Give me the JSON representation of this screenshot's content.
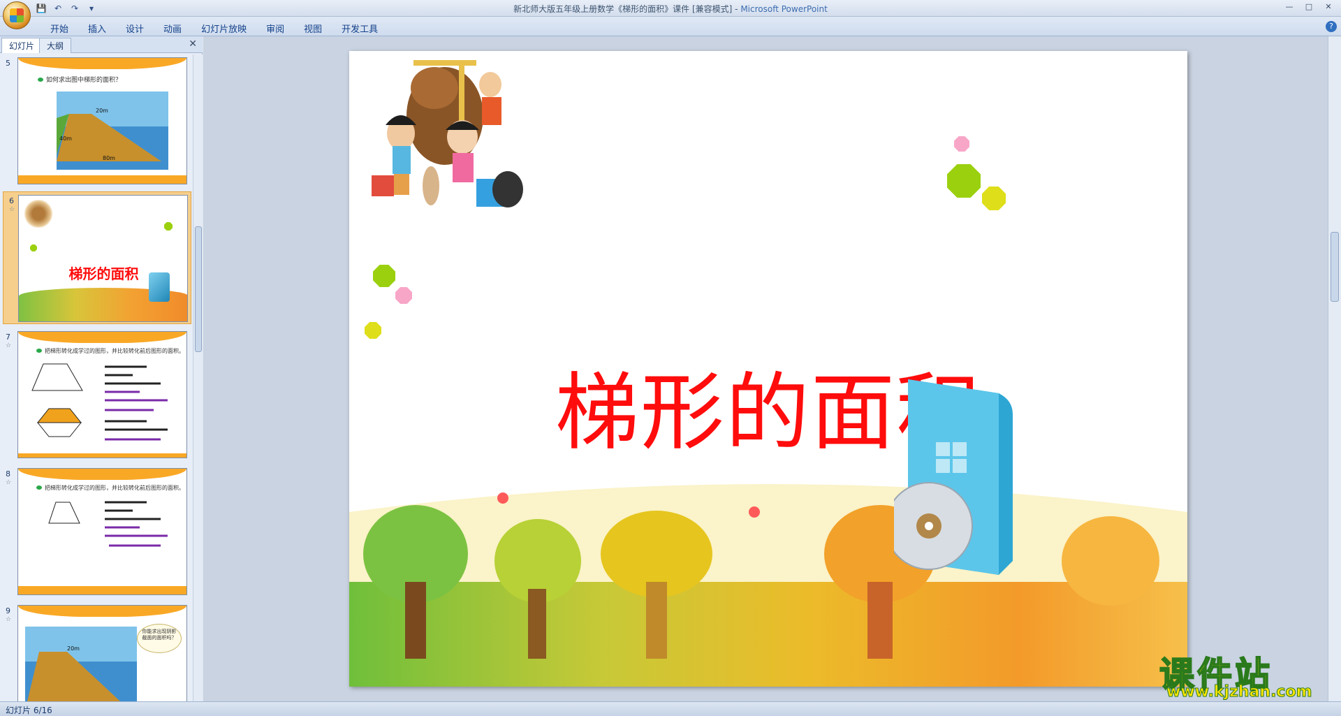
{
  "window": {
    "title_doc": "新北师大版五年级上册数学《梯形的面积》课件 [兼容模式] - ",
    "title_app": "Microsoft PowerPoint"
  },
  "ribbon": {
    "tabs": [
      "开始",
      "插入",
      "设计",
      "动画",
      "幻灯片放映",
      "审阅",
      "视图",
      "开发工具"
    ]
  },
  "left_pane": {
    "tabs": [
      "幻灯片",
      "大纲"
    ],
    "slides": [
      {
        "number": "5",
        "text": "如何求出图中梯形的面积？",
        "labels": [
          "20m",
          "40m",
          "80m"
        ]
      },
      {
        "number": "6",
        "title": "梯形的面积",
        "selected": true
      },
      {
        "number": "7",
        "text": "把梯形转化成学过的图形，并比较转化前后图形的面积。"
      },
      {
        "number": "8",
        "text": "把梯形转化成学过的图形，并比较转化前后图形的面积。"
      },
      {
        "number": "9",
        "text": "你能求出现阴影截面的面积吗？",
        "labels": [
          "20m"
        ]
      }
    ]
  },
  "slide": {
    "title": "梯形的面积"
  },
  "status": {
    "slide_indicator": "幻灯片 6/16"
  },
  "watermark": {
    "main": "课件站",
    "url": "www.kjzhan.com"
  }
}
